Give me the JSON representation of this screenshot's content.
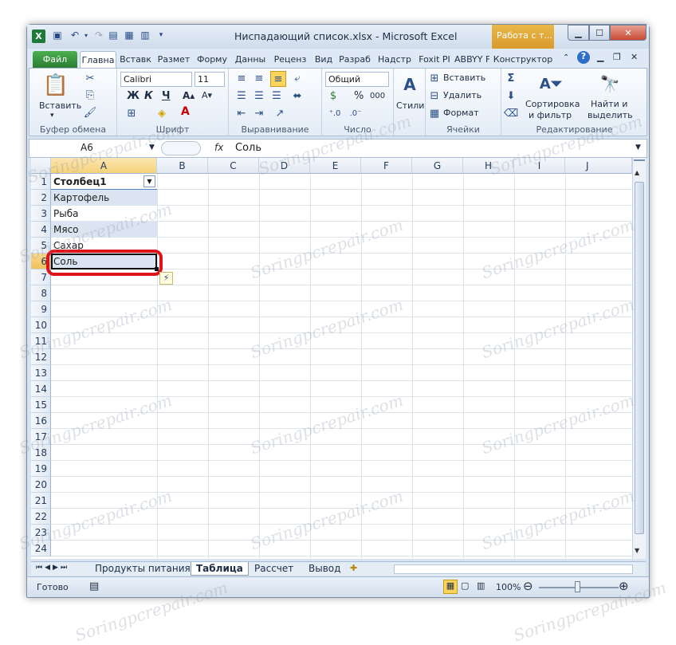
{
  "window": {
    "title": "Ниспадающий список.xlsx - Microsoft Excel",
    "context_tab": "Работа с т..."
  },
  "tabs": [
    "Файл",
    "Главна",
    "Вставк",
    "Размет",
    "Форму",
    "Данны",
    "Реценз",
    "Вид",
    "Разраб",
    "Надстр",
    "Foxit PI",
    "ABBYY F",
    "Конструктор"
  ],
  "ribbon": {
    "clipboard": {
      "paste": "Вставить",
      "label": "Буфер обмена"
    },
    "font": {
      "name": "Calibri",
      "size": "11",
      "bold": "Ж",
      "italic": "К",
      "underline": "Ч",
      "label": "Шрифт"
    },
    "alignment": {
      "label": "Выравнивание"
    },
    "number": {
      "format": "Общий",
      "percent": "%",
      "thousands": "000",
      "label": "Число"
    },
    "styles": {
      "label": "Стили"
    },
    "cells": {
      "insert": "Вставить",
      "delete": "Удалить",
      "format": "Формат",
      "label": "Ячейки"
    },
    "editing": {
      "sort": "Сортировка",
      "sort2": "и фильтр",
      "find": "Найти и",
      "find2": "выделить",
      "label": "Редактирование"
    }
  },
  "formula_bar": {
    "name_box": "A6",
    "fx": "fx",
    "value": "Соль"
  },
  "columns": [
    "A",
    "B",
    "C",
    "D",
    "E",
    "F",
    "G",
    "H",
    "I",
    "J"
  ],
  "rows": [
    "1",
    "2",
    "3",
    "4",
    "5",
    "6",
    "7",
    "8",
    "9",
    "10",
    "11",
    "12",
    "13",
    "14",
    "15",
    "16",
    "17",
    "18",
    "19",
    "20",
    "21",
    "22",
    "23",
    "24"
  ],
  "table": {
    "header": "Столбец1",
    "values": [
      "Картофель",
      "Рыба",
      "Мясо",
      "Сахар",
      "Соль"
    ]
  },
  "sheet_tabs": [
    "Продукты питания",
    "Таблица",
    "Рассчет",
    "Вывод"
  ],
  "active_sheet": "Таблица",
  "status": {
    "ready": "Готово",
    "zoom": "100%"
  },
  "watermark": "Soringpcrepair.com",
  "colors": {
    "selection_ring": "#e0131a",
    "table_band": "#dbe5f1",
    "file_tab": "#2a7d32"
  }
}
